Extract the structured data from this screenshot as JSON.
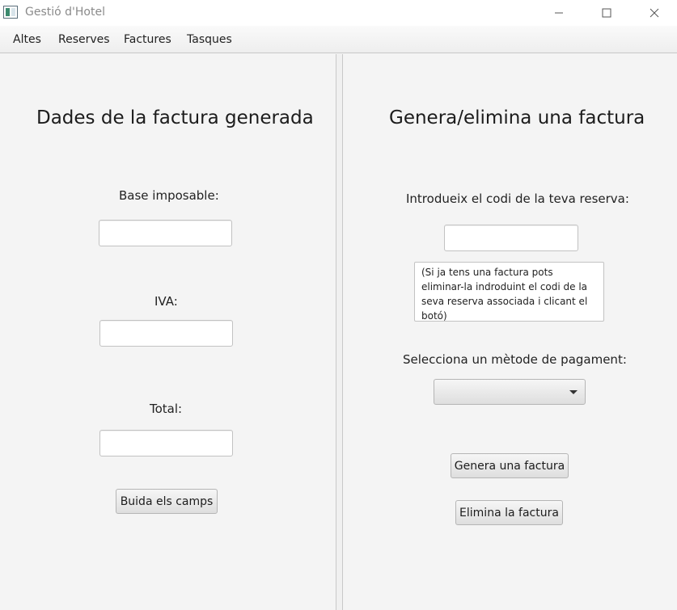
{
  "window": {
    "title": "Gestió d'Hotel",
    "controls": [
      "minimize-icon",
      "maximize-icon",
      "close-icon"
    ]
  },
  "menu": {
    "items": [
      "Altes",
      "Reserves",
      "Factures",
      "Tasques"
    ]
  },
  "left_panel": {
    "heading": "Dades de la factura generada",
    "base_label": "Base imposable:",
    "base_value": "",
    "iva_label": "IVA:",
    "iva_value": "",
    "total_label": "Total:",
    "total_value": "",
    "clear_button": "Buida els camps"
  },
  "right_panel": {
    "heading": "Genera/elimina una factura",
    "code_label": "Introdueix el codi de la teva reserva:",
    "code_value": "",
    "note": "(Si ja tens una factura pots eliminar-la indroduint el codi de la seva reserva associada i clicant el botó)",
    "payment_label": "Selecciona un mètode de pagament:",
    "payment_selected": "",
    "generate_button": "Genera una factura",
    "delete_button": "Elimina la factura"
  }
}
